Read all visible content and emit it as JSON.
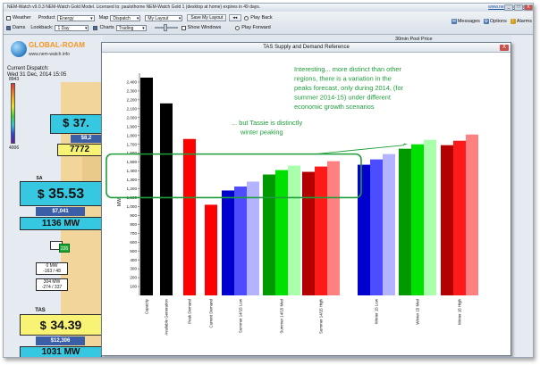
{
  "app": {
    "title": "NEM-Watch v9.0.3 NEM-Watch Gold Model.   Licensed to: paulothome    NEM-Watch Gold 1 (desktop at home) expires in 49 days.",
    "website": "www.nem-watch.info",
    "controls": {
      "minimize": "_",
      "maximize": "□",
      "close": "X"
    }
  },
  "toolbar": {
    "row1": {
      "weather_label": "Weather",
      "product_label": "Product",
      "product_value": "Energy",
      "map_label": "Map",
      "map_value": "Dispatch",
      "layout_value": "My Layout",
      "save_layout": "Save My Layout",
      "play_back": "Play Back"
    },
    "row2": {
      "dams_label": "Dams",
      "lookback_label": "Lookback:",
      "lookback_value": "1 Day",
      "charts_label": "Charts",
      "charts_value": "Trading",
      "show_windows": "Show Windows",
      "play_forward": "Play Forward"
    },
    "right": {
      "messages": "Messages",
      "options": "Options",
      "alarms": "Alarms"
    }
  },
  "left": {
    "logo_name": "GLOBAL-ROAM",
    "logo_url": "www.nem-watch.info",
    "current_dispatch_label": "Current Dispatch:",
    "current_dispatch_value": "Wed 31 Dec, 2014 15:05",
    "scale_top": "8943",
    "scale_bottom": "4006",
    "regions": [
      {
        "price_prefix": "$",
        "price": "37.",
        "sub": "$8,2",
        "mw": "7772"
      },
      {
        "label": "SA",
        "price_prefix": "$",
        "price": "35.53",
        "sub": "$7,041",
        "mw": "1136 MW"
      },
      {
        "label": "TAS",
        "price_prefix": "$",
        "price": "34.39",
        "sub": "$12,306",
        "mw": "1031 MW"
      }
    ],
    "flows": [
      {
        "line1": "0 MW",
        "line2": "-163 / 48"
      },
      {
        "line1": "304 MW",
        "line2": "-274 / 337"
      }
    ],
    "flow_badge": "226"
  },
  "pool_header": "30min Pool Price",
  "chart_window": {
    "title": "TAS Supply and Demand Reference",
    "close": "X"
  },
  "chart_data": {
    "type": "bar",
    "title": "",
    "xlabel": "",
    "ylabel": "MW",
    "ylim": [
      0,
      2500
    ],
    "yticks": [
      100,
      200,
      300,
      400,
      500,
      600,
      700,
      800,
      900,
      1000,
      1100,
      1200,
      1300,
      1400,
      1500,
      1600,
      1700,
      1800,
      1900,
      2000,
      2100,
      2200,
      2300,
      2400
    ],
    "ytick_labels": [
      "100",
      "200",
      "300",
      "400",
      "500",
      "600",
      "700",
      "800",
      "900",
      "1,000",
      "1,100",
      "1,200",
      "1,300",
      "1,400",
      "1,500",
      "1,600",
      "1,700",
      "1,800",
      "1,900",
      "2,000",
      "2,100",
      "2,200",
      "2,300",
      "2,400"
    ],
    "categories": [
      "Capacity",
      "Available Generation",
      "Peak Demand",
      "Current Demand",
      "Summer 14/15 Low",
      "Summer 14/15 Med",
      "Summer 14/15 High",
      "Winter 15 Low",
      "Winter 15 Med",
      "Winter 15 High"
    ],
    "groups": [
      {
        "label": "Capacity",
        "values": [
          2450
        ],
        "colors": [
          "#000000"
        ]
      },
      {
        "label": "Available Generation",
        "values": [
          2160
        ],
        "colors": [
          "#000000"
        ]
      },
      {
        "label": "Peak Demand",
        "values": [
          1760
        ],
        "colors": [
          "#ff0000"
        ]
      },
      {
        "label": "Current Demand",
        "values": [
          1020
        ],
        "colors": [
          "#ff0000"
        ]
      },
      {
        "label": "Summer 14/15 Low",
        "values": [
          1180,
          1225,
          1280
        ],
        "colors": [
          "#0000cc",
          "#4d4dff",
          "#b3b3ff"
        ]
      },
      {
        "label": "Summer 14/15 Med",
        "values": [
          1360,
          1410,
          1460
        ],
        "colors": [
          "#009900",
          "#00e000",
          "#aaffaa"
        ]
      },
      {
        "label": "Summer 14/15 High",
        "values": [
          1390,
          1450,
          1510
        ],
        "colors": [
          "#b30000",
          "#ff1a1a",
          "#ff8080"
        ]
      },
      {
        "label": "Winter 15 Low",
        "values": [
          1470,
          1530,
          1590
        ],
        "colors": [
          "#0000cc",
          "#4d4dff",
          "#b3b3ff"
        ]
      },
      {
        "label": "Winter 15 Med",
        "values": [
          1650,
          1700,
          1750
        ],
        "colors": [
          "#009900",
          "#00e000",
          "#aaffaa"
        ]
      },
      {
        "label": "Winter 15 High",
        "values": [
          1690,
          1740,
          1810
        ],
        "colors": [
          "#b30000",
          "#ff1a1a",
          "#ff8080"
        ]
      }
    ],
    "annotations": {
      "top_lines": [
        "Interesting... more distinct than other",
        "regions, there is a variation in the",
        "peaks forecast, only during 2014, (for",
        "summer 2014-15) under different",
        "economic growth scenarios"
      ],
      "tassie_lines": [
        "... but Tassie is distinctly",
        "winter peaking"
      ],
      "color": "#1e9e3a"
    },
    "grid": false,
    "legend": "none"
  }
}
